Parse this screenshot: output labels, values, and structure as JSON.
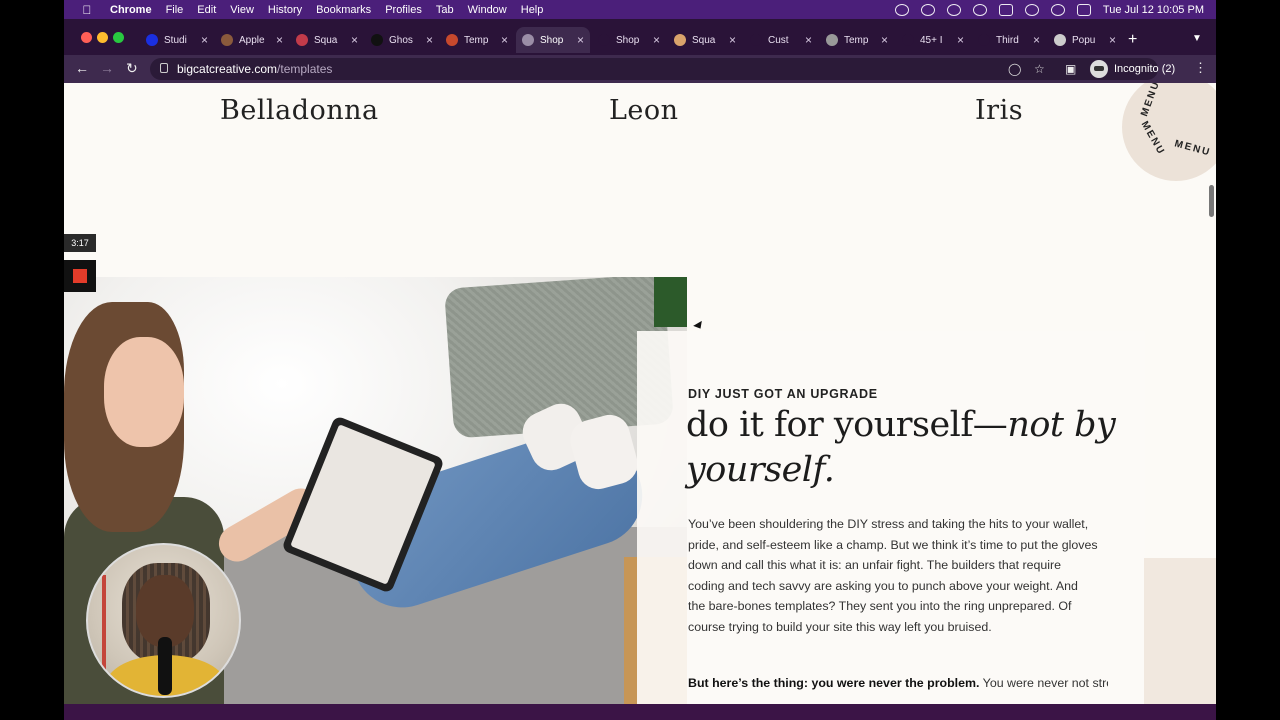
{
  "menubar": {
    "app": "Chrome",
    "items": [
      "File",
      "Edit",
      "View",
      "History",
      "Bookmarks",
      "Profiles",
      "Tab",
      "Window",
      "Help"
    ],
    "clock": "Tue Jul 12  10:05 PM"
  },
  "tabs": [
    {
      "label": "Studi",
      "color": "#1a2fe0"
    },
    {
      "label": "Apple",
      "color": "#8a5a3c"
    },
    {
      "label": "Squa",
      "color": "#c23b4a"
    },
    {
      "label": "Ghos",
      "color": "#111111"
    },
    {
      "label": "Temp",
      "color": "#c7492d"
    },
    {
      "label": "Shop",
      "color": "#9b8ea7"
    },
    {
      "label": "Shop",
      "color": "#2a1338"
    },
    {
      "label": "Squa",
      "color": "#d9a36b"
    },
    {
      "label": "Cust",
      "color": "#2a1338"
    },
    {
      "label": "Temp",
      "color": "#999999"
    },
    {
      "label": "45+ I",
      "color": "#2a1338"
    },
    {
      "label": "Third",
      "color": "#2a1338"
    },
    {
      "label": "Popu",
      "color": "#cccccc"
    }
  ],
  "toolbar": {
    "url_domain": "bigcatcreative.com",
    "url_path": "/templates",
    "incognito_label": "Incognito (2)"
  },
  "page": {
    "templates": [
      "Belladonna",
      "Leon",
      "Iris"
    ],
    "menu_badge": "MENU",
    "eyebrow": "DIY JUST GOT AN UPGRADE",
    "headline_plain": "do it for yourself—",
    "headline_italic": "not by yourself.",
    "body1": "You’ve been shouldering the DIY stress and taking the hits to your wallet, pride, and self-esteem like a champ. But we think it’s time to put the gloves down and call this what it is: an unfair fight. The builders that require coding and tech savvy are asking you to punch above your weight. And the bare-bones templates? They sent you into the ring unprepared. Of course trying to build your site this way left you bruised.",
    "body2_bold": "But here’s the thing: you were never the problem.",
    "body2_rest": " You were never not strong enough, capable enough, or scrappy enough to win. The odds"
  },
  "recorder": {
    "timer": "3:17"
  }
}
